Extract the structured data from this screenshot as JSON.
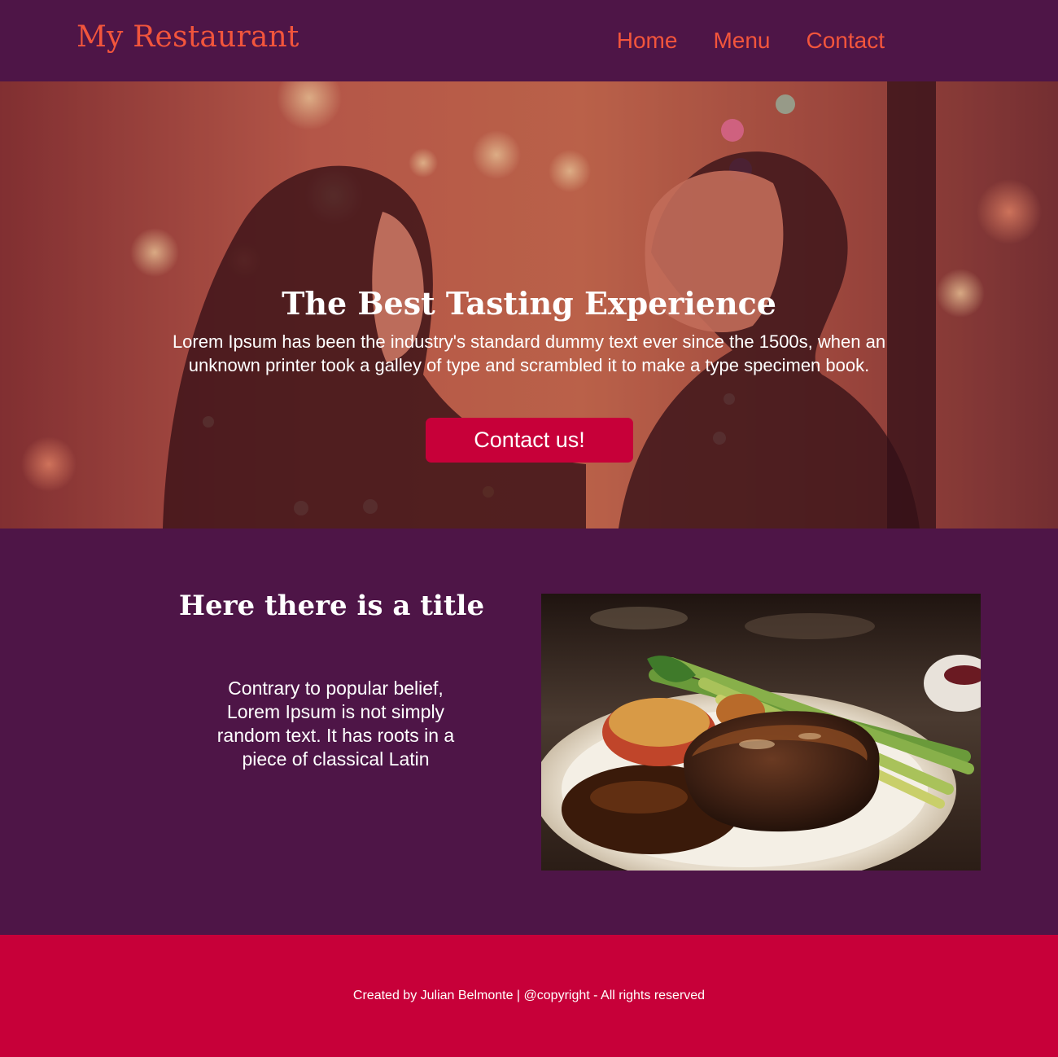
{
  "header": {
    "logo": "My Restaurant",
    "nav": [
      {
        "label": "Home"
      },
      {
        "label": "Menu"
      },
      {
        "label": "Contact"
      }
    ]
  },
  "hero": {
    "title": "The Best Tasting Experience",
    "text": "Lorem Ipsum has been the industry's standard dummy text ever since the 1500s, when an unknown printer took a galley of type and scrambled it to make a type specimen book.",
    "button_label": "Contact us!",
    "image": "couple-dining-photo"
  },
  "feature": {
    "title": "Here there is a title",
    "text": "Contrary to popular belief, Lorem Ipsum is not simply random text. It has roots in a piece of classical Latin",
    "image": "steak-dinner-plate-photo"
  },
  "footer": {
    "text": "Created by Julian Belmonte | @copyright - All rights reserved"
  },
  "colors": {
    "background": "#4e1547",
    "accent": "#f2553c",
    "button": "#c70039",
    "footer": "#c70039",
    "text": "#ffffff"
  }
}
